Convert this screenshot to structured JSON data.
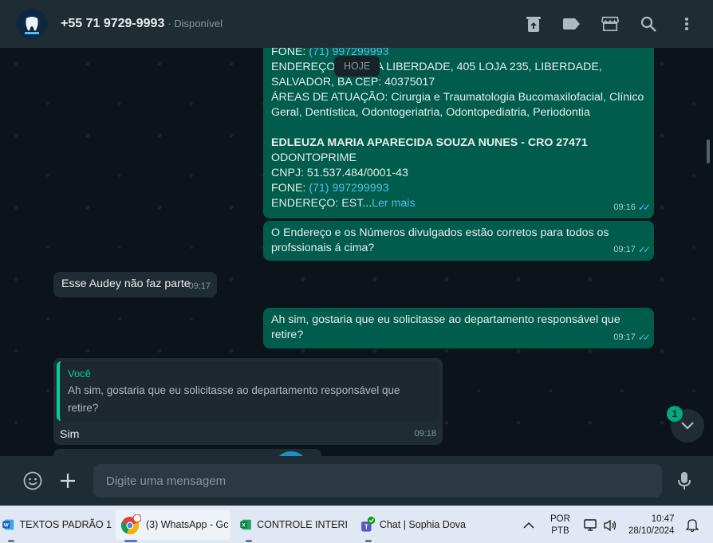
{
  "header": {
    "contact_name": "+55 71 9729-9993",
    "contact_status": "· Disponível",
    "icons": [
      "archive-icon",
      "label-icon",
      "store-icon",
      "search-icon",
      "menu-icon"
    ]
  },
  "chat": {
    "date_label": "HOJE",
    "messages": [
      {
        "type": "outgoing",
        "lines": [
          {
            "prefix": "FONE: ",
            "link": "(71) 997299993"
          },
          {
            "text": "ENDEREÇO: RUA DA LIBERDADE, 405 LOJA 235, LIBERDADE,"
          },
          {
            "text": "SALVADOR, BA CEP: 40375017"
          },
          {
            "text": "ÁREAS DE ATUAÇÃO: Cirurgia e Traumatologia Bucomaxilofacial, Clínico"
          },
          {
            "text": "Geral, Dentística, Odontogeriatria, Odontopediatria, Periodontia"
          },
          {
            "text": ""
          },
          {
            "text": "EDLEUZA MARIA APARECIDA SOUZA NUNES - CRO 27471",
            "bold": true
          },
          {
            "text": "ODONTOPRIME"
          },
          {
            "text": "CNPJ: 51.537.484/0001-43"
          },
          {
            "prefix": "FONE: ",
            "link": "(71) 997299993"
          },
          {
            "prefix": "ENDEREÇO: EST...",
            "link": "Ler mais"
          }
        ],
        "time": "09:16"
      },
      {
        "type": "outgoing",
        "lines": [
          {
            "text": "O Endereço e os Números divulgados estão corretos para todos os"
          },
          {
            "text": "profssionais á cima?"
          }
        ],
        "time": "09:17"
      },
      {
        "type": "incoming",
        "text": "Esse Audey não faz parte",
        "time": "09:17"
      },
      {
        "type": "outgoing",
        "lines": [
          {
            "text": "Ah sim, gostaria que eu solicitasse ao departamento responsável que"
          },
          {
            "text": "retire?"
          }
        ],
        "time": "09:17"
      },
      {
        "type": "incoming-reply",
        "quote_author": "Você",
        "quote_lines": [
          "Ah sim, gostaria que eu solicitasse ao departamento responsável que",
          "retire?"
        ],
        "text": "Sim",
        "time": "09:18"
      }
    ],
    "unread_count": "1"
  },
  "composer": {
    "placeholder": "Digite uma mensagem"
  },
  "taskbar": {
    "apps": [
      {
        "label": "TEXTOS PADRÃO 1",
        "icon": "word-icon"
      },
      {
        "label": "(3) WhatsApp - Gc",
        "icon": "chrome-icon"
      },
      {
        "label": "CONTROLE INTERI",
        "icon": "excel-icon"
      },
      {
        "label": "Chat | Sophia Dova",
        "icon": "teams-icon"
      }
    ],
    "lang_top": "POR",
    "lang_bottom": "PTB",
    "time": "10:47",
    "date": "28/10/2024"
  },
  "colors": {
    "header_bg": "#202c33",
    "outgoing_bubble": "#005c4b",
    "incoming_bubble": "#202c33",
    "accent_green": "#00a884",
    "link_blue": "#53bdeb"
  }
}
